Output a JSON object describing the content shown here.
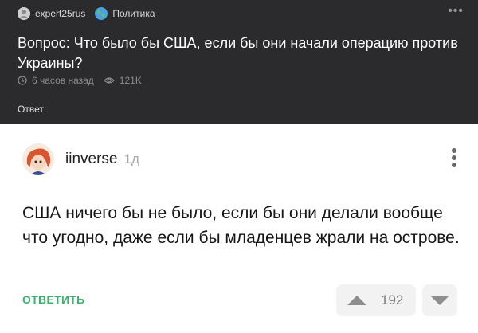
{
  "question_header": {
    "author": "expert25rus",
    "community": "Политика",
    "question_text": "Вопрос: Что было бы США, если бы они начали операцию против Украины?",
    "time_ago": "6 часов назад",
    "views": "121K",
    "answer_label": "Ответ:"
  },
  "answer": {
    "username": "iinverse",
    "time_ago": "1д",
    "text": "США ничего бы не было, если бы они делали вообще что угодно, даже если бы младенцев жрали на острове.",
    "reply_label": "ОТВЕТИТЬ",
    "votes": "192"
  },
  "icons": {
    "author_avatar": "avatar-icon",
    "community": "globe-icon",
    "menu_header": "more-horizontal-icon",
    "clock": "clock-icon",
    "views": "eye-icon",
    "menu_card": "more-vertical-icon",
    "upvote": "upvote-arrow-icon",
    "downvote": "downvote-arrow-icon"
  },
  "colors": {
    "header_bg": "#2b2b2d",
    "accent_green": "#35b36a",
    "vote_bg": "#f2f2f2"
  }
}
